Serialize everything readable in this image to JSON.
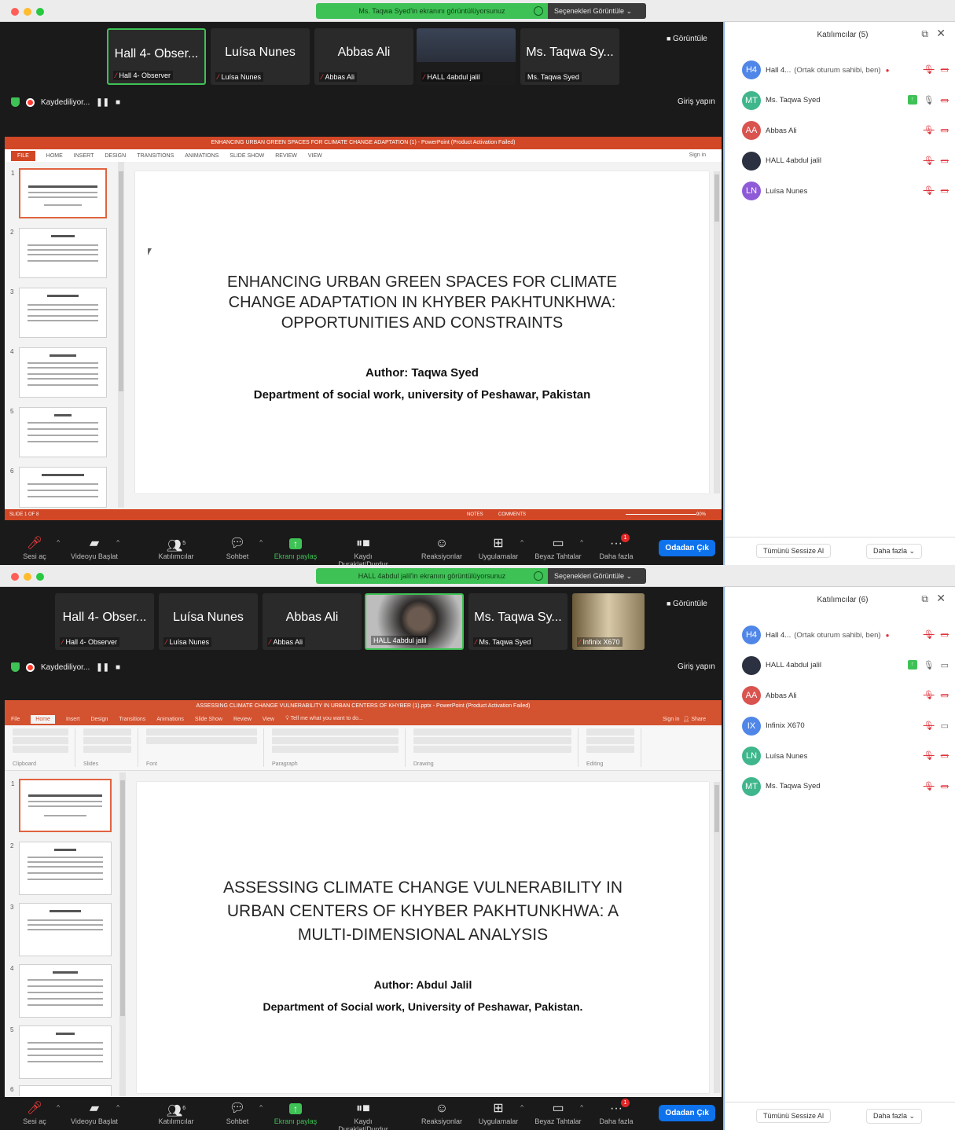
{
  "top": {
    "share_banner": "Ms. Taqwa Syed'in ekranını görüntülüyorsunuz",
    "view_options": "Seçenekleri Görüntüle",
    "view_button": "Görüntüle",
    "recording": "Kaydediliyor...",
    "signin": "Giriş yapın",
    "tiles": [
      {
        "name": "Hall 4- Obser...",
        "label": "Hall 4- Observer",
        "muted": true,
        "active": true
      },
      {
        "name": "Luísa Nunes",
        "label": "Luísa Nunes",
        "muted": true
      },
      {
        "name": "Abbas Ali",
        "label": "Abbas Ali",
        "muted": true
      },
      {
        "name": "",
        "label": "HALL 4abdul jalil",
        "muted": true,
        "video": true
      },
      {
        "name": "Ms. Taqwa Sy...",
        "label": "Ms. Taqwa Syed",
        "muted": false
      }
    ],
    "ppt": {
      "title": "ENHANCING URBAN GREEN SPACES FOR CLIMATE CHANGE ADAPTATION (1) - PowerPoint (Product Activation Failed)",
      "menus": [
        "FILE",
        "HOME",
        "INSERT",
        "DESIGN",
        "TRANSITIONS",
        "ANIMATIONS",
        "SLIDE SHOW",
        "REVIEW",
        "VIEW"
      ],
      "signin": "Sign in",
      "slide_title": "ENHANCING URBAN GREEN SPACES FOR CLIMATE CHANGE ADAPTATION IN KHYBER PAKHTUNKHWA: OPPORTUNITIES AND CONSTRAINTS",
      "author": "Author: Taqwa Syed",
      "dept": "Department of social work, university of Peshawar, Pakistan",
      "status_slide": "SLIDE 1 OF 8",
      "status_notes": "NOTES",
      "status_comments": "COMMENTS",
      "zoom": "90%",
      "thumb_numbers": [
        "1",
        "2",
        "3",
        "4",
        "5",
        "6"
      ],
      "thumb_titles": [
        "",
        "Introduction",
        "Literature Review",
        "Methodology",
        "Findings",
        "Policy Recommendations"
      ]
    },
    "participants_title": "Katılımcılar (5)",
    "participants": [
      {
        "initials": "H4",
        "color": "#4f86e8",
        "name": "Hall 4...",
        "extra": "(Ortak oturum sahibi, ben)",
        "rec": true,
        "mic": "muted",
        "cam": "off"
      },
      {
        "initials": "MT",
        "color": "#3fb68b",
        "name": "Ms. Taqwa Syed",
        "share": true,
        "mic": "on",
        "cam": "off"
      },
      {
        "initials": "AA",
        "color": "#d9534f",
        "name": "Abbas Ali",
        "mic": "muted",
        "cam": "off"
      },
      {
        "initials": "",
        "color": "#2b3140",
        "name": "HALL 4abdul jalil",
        "mic": "muted",
        "cam": "off"
      },
      {
        "initials": "LN",
        "color": "#8e5ad8",
        "name": "Luísa Nunes",
        "mic": "muted",
        "cam": "off"
      }
    ],
    "mute_all": "Tümünü Sessize Al",
    "more": "Daha fazla"
  },
  "bottom": {
    "share_banner": "HALL 4abdul jalil'in ekranını görüntülüyorsunuz",
    "view_options": "Seçenekleri Görüntüle",
    "view_button": "Görüntüle",
    "recording": "Kaydediliyor...",
    "signin": "Giriş yapın",
    "tiles": [
      {
        "name": "Hall 4- Obser...",
        "label": "Hall 4- Observer",
        "muted": true
      },
      {
        "name": "Luísa Nunes",
        "label": "Luísa Nunes",
        "muted": true
      },
      {
        "name": "Abbas Ali",
        "label": "Abbas Ali",
        "muted": true
      },
      {
        "name": "",
        "label": "HALL 4abdul jalil",
        "muted": false,
        "video": true,
        "active": true
      },
      {
        "name": "Ms. Taqwa Sy...",
        "label": "Ms. Taqwa Syed",
        "muted": true
      },
      {
        "name": "",
        "label": "Infinix X670",
        "muted": true,
        "video": true
      }
    ],
    "ppt": {
      "title": "ASSESSING CLIMATE CHANGE VULNERABILITY IN URBAN CENTERS OF KHYBER (1).pptx - PowerPoint (Product Activation Failed)",
      "menus": [
        "File",
        "Home",
        "Insert",
        "Design",
        "Transitions",
        "Animations",
        "Slide Show",
        "Review",
        "View"
      ],
      "tell": "Tell me what you want to do...",
      "signin": "Sign in",
      "share": "Share",
      "ribbon_groups": [
        "Clipboard",
        "Slides",
        "Font",
        "Paragraph",
        "Drawing",
        "Editing"
      ],
      "slide_title": "ASSESSING CLIMATE CHANGE VULNERABILITY IN URBAN CENTERS OF KHYBER PAKHTUNKHWA: A MULTI-DIMENSIONAL ANALYSIS",
      "author": "Author: Abdul Jalil",
      "dept": "Department of Social work, University of Peshawar, Pakistan.",
      "thumb_numbers": [
        "1",
        "2",
        "3",
        "4",
        "5",
        "6"
      ],
      "thumb_titles": [
        "",
        "Introduction",
        "Literature Review",
        "Methodology",
        "Findings",
        "Conclusion"
      ]
    },
    "participants_title": "Katılımcılar (6)",
    "participants": [
      {
        "initials": "H4",
        "color": "#4f86e8",
        "name": "Hall 4...",
        "extra": "(Ortak oturum sahibi, ben)",
        "rec": true,
        "mic": "muted",
        "cam": "off"
      },
      {
        "initials": "",
        "color": "#2b3140",
        "name": "HALL 4abdul jalil",
        "share": true,
        "mic": "on",
        "cam": "on"
      },
      {
        "initials": "AA",
        "color": "#d9534f",
        "name": "Abbas Ali",
        "mic": "muted",
        "cam": "off"
      },
      {
        "initials": "IX",
        "color": "#4f86e8",
        "name": "Infinix X670",
        "mic": "muted",
        "cam": "on"
      },
      {
        "initials": "LN",
        "color": "#3fb68b",
        "name": "Luísa Nunes",
        "mic": "muted",
        "cam": "off"
      },
      {
        "initials": "MT",
        "color": "#3fb68b",
        "name": "Ms. Taqwa Syed",
        "mic": "muted",
        "cam": "off"
      }
    ],
    "mute_all": "Tümünü Sessize Al",
    "more": "Daha fazla"
  },
  "toolbar": {
    "items": [
      "Sesi aç",
      "Videoyu Başlat",
      "Katılımcılar",
      "Sohbet",
      "Ekranı paylaş",
      "Kaydı Duraklat/Durdur",
      "Reaksiyonlar",
      "Uygulamalar",
      "Beyaz Tahtalar",
      "Daha fazla"
    ],
    "participants_count_top": "5",
    "participants_count_bottom": "6",
    "more_badge": "1",
    "leave": "Odadan Çık"
  },
  "colors": {
    "zoom_green": "#3ec255",
    "zoom_blue": "#0e72ed",
    "ppt_red_old": "#d24726",
    "ppt_red_new": "#d35230"
  }
}
